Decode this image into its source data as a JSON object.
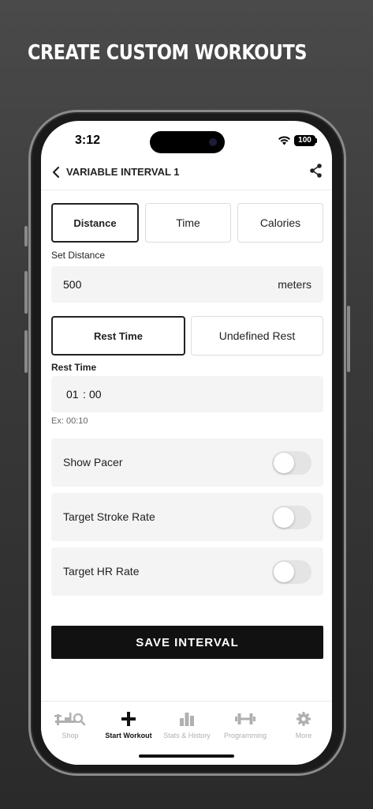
{
  "headline": "CREATE CUSTOM WORKOUTS",
  "status": {
    "time": "3:12",
    "battery": "100"
  },
  "header": {
    "title": "VARIABLE INTERVAL 1"
  },
  "interval_type": {
    "options": [
      "Distance",
      "Time",
      "Calories"
    ],
    "selected": "Distance"
  },
  "distance": {
    "label": "Set Distance",
    "value": "500",
    "unit": "meters"
  },
  "rest_type": {
    "options": [
      "Rest Time",
      "Undefined Rest"
    ],
    "selected": "Rest Time"
  },
  "rest_time": {
    "label": "Rest Time",
    "minutes": "01",
    "separator": ":",
    "seconds": "00",
    "hint": "Ex: 00:10"
  },
  "toggles": [
    {
      "label": "Show Pacer",
      "on": false
    },
    {
      "label": "Target Stroke Rate",
      "on": false
    },
    {
      "label": "Target HR Rate",
      "on": false
    }
  ],
  "save_label": "SAVE INTERVAL",
  "tabs": [
    {
      "label": "Shop",
      "icon": "rower-search-icon",
      "active": false
    },
    {
      "label": "Start Workout",
      "icon": "plus-icon",
      "active": true
    },
    {
      "label": "Stats & History",
      "icon": "bar-chart-icon",
      "active": false
    },
    {
      "label": "Programming",
      "icon": "dumbbell-icon",
      "active": false
    },
    {
      "label": "More",
      "icon": "gear-icon",
      "active": false
    }
  ],
  "colors": {
    "accent": "#111111",
    "inactive_tab": "#b0b0b0",
    "field_bg": "#f4f4f4"
  }
}
